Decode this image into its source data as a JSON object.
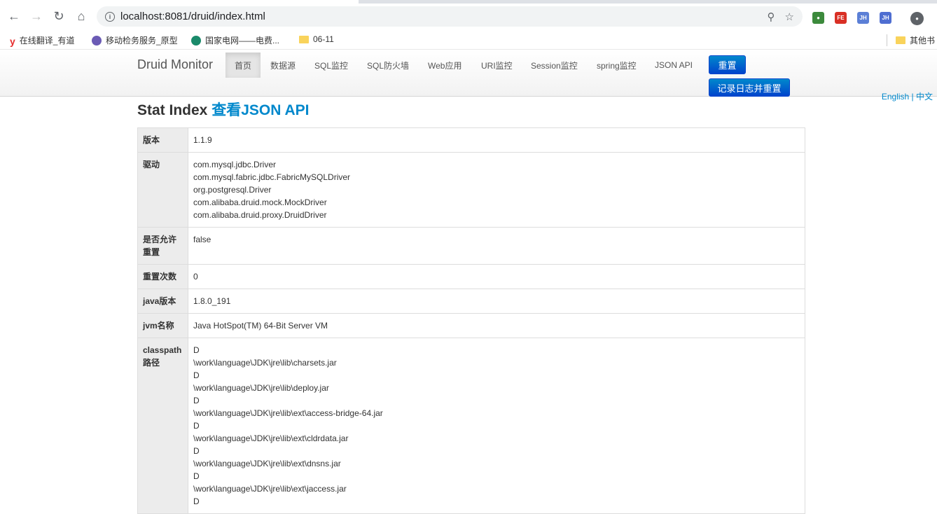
{
  "browser": {
    "url": "localhost:8081/druid/index.html",
    "bookmarks": [
      {
        "label": "在线翻译_有道"
      },
      {
        "label": "移动检务服务_原型"
      },
      {
        "label": "国家电网——电费..."
      },
      {
        "label": "06-11"
      }
    ],
    "other_bookmarks": "其他书",
    "extensions": [
      "FE",
      "JH",
      "JH"
    ]
  },
  "nav": {
    "brand": "Druid Monitor",
    "links": [
      "首页",
      "数据源",
      "SQL监控",
      "SQL防火墙",
      "Web应用",
      "URI监控",
      "Session监控",
      "spring监控",
      "JSON API"
    ],
    "reset_button": "重置",
    "log_reset_button": "记录日志并重置"
  },
  "lang": "English | 中文",
  "page": {
    "title": "Stat Index",
    "title_link": "查看JSON API"
  },
  "stats": [
    {
      "key": "版本",
      "value": [
        "1.1.9"
      ]
    },
    {
      "key": "驱动",
      "value": [
        "com.mysql.jdbc.Driver",
        "com.mysql.fabric.jdbc.FabricMySQLDriver",
        "org.postgresql.Driver",
        "com.alibaba.druid.mock.MockDriver",
        "com.alibaba.druid.proxy.DruidDriver"
      ]
    },
    {
      "key": "是否允许重置",
      "value": [
        "false"
      ]
    },
    {
      "key": "重置次数",
      "value": [
        "0"
      ]
    },
    {
      "key": "java版本",
      "value": [
        "1.8.0_191"
      ]
    },
    {
      "key": "jvm名称",
      "value": [
        "Java HotSpot(TM) 64-Bit Server VM"
      ]
    },
    {
      "key": "classpath路径",
      "value": [
        "D",
        "\\work\\language\\JDK\\jre\\lib\\charsets.jar",
        "D",
        "\\work\\language\\JDK\\jre\\lib\\deploy.jar",
        "D",
        "\\work\\language\\JDK\\jre\\lib\\ext\\access-bridge-64.jar",
        "D",
        "\\work\\language\\JDK\\jre\\lib\\ext\\cldrdata.jar",
        "D",
        "\\work\\language\\JDK\\jre\\lib\\ext\\dnsns.jar",
        "D",
        "\\work\\language\\JDK\\jre\\lib\\ext\\jaccess.jar",
        "D"
      ]
    }
  ]
}
